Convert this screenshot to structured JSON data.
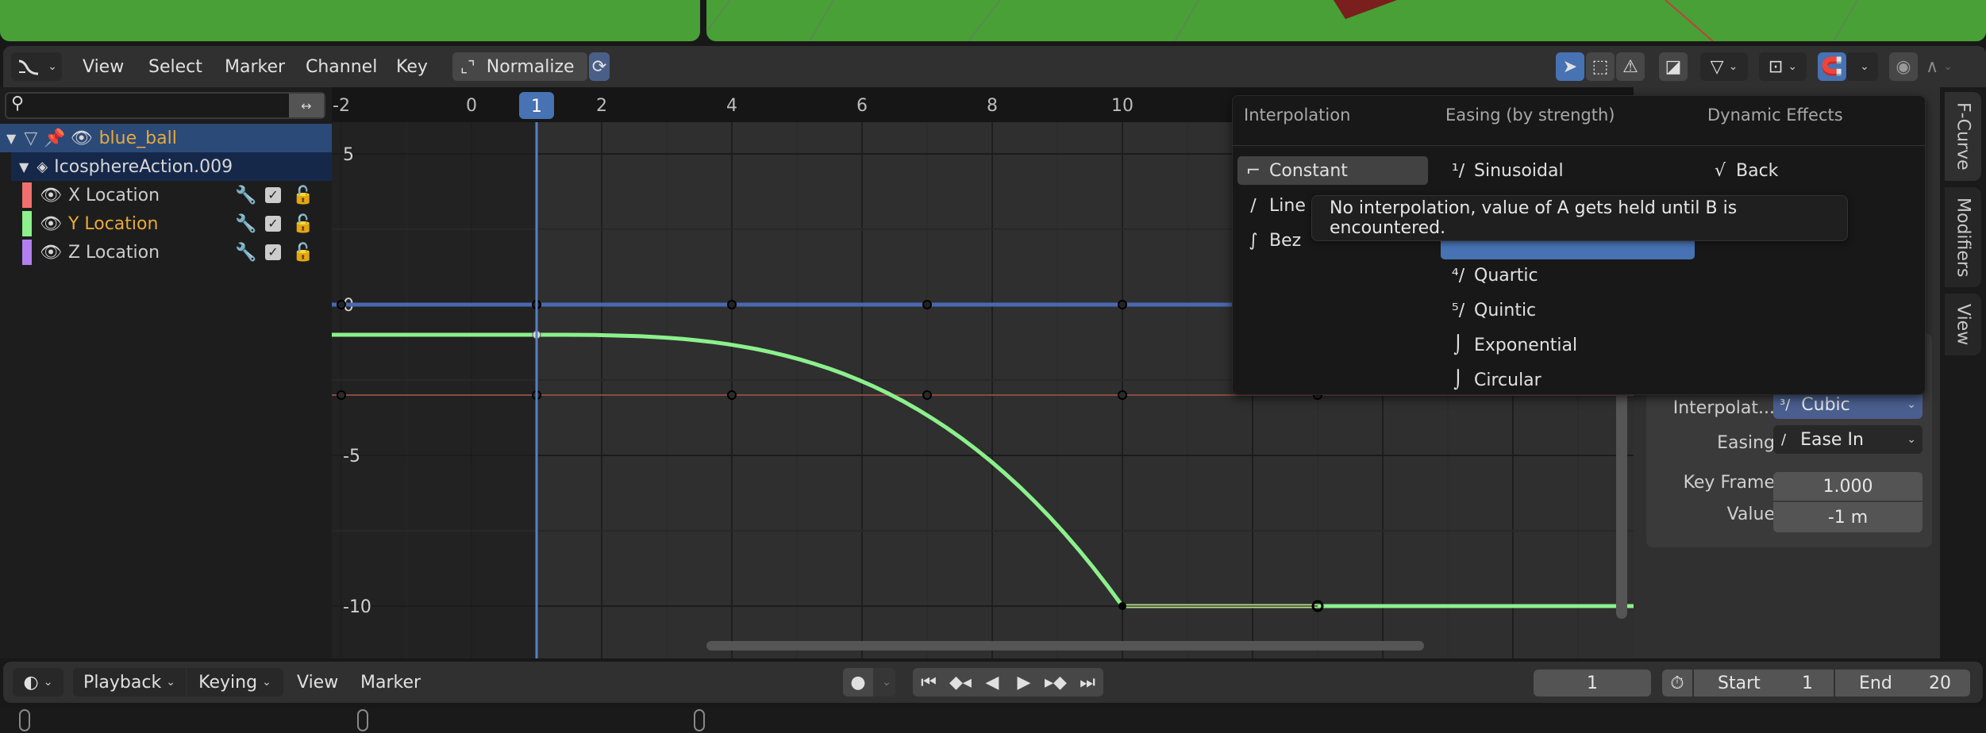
{
  "header": {
    "menus": [
      "View",
      "Select",
      "Marker",
      "Channel",
      "Key"
    ],
    "normalize_label": "Normalize"
  },
  "ruler": {
    "ticks": [
      "-2",
      "0",
      "2",
      "4",
      "6",
      "8",
      "10"
    ],
    "current_frame": "1"
  },
  "yaxis": {
    "ticks": [
      "5",
      "0",
      "-5",
      "-10"
    ]
  },
  "channels": {
    "object": "blue_ball",
    "action": "IcosphereAction.009",
    "fcurves": [
      {
        "label": "X Location",
        "color": "#f07070",
        "selected": false
      },
      {
        "label": "Y Location",
        "color": "#8cf08c",
        "selected": true
      },
      {
        "label": "Z Location",
        "color": "#b080f0",
        "selected": false
      }
    ]
  },
  "graph": {
    "curves": {
      "x_location": {
        "color": "#8a4a40",
        "value": -3,
        "keyframes": [
          -2,
          1,
          4,
          7,
          10,
          13
        ]
      },
      "z_location": {
        "color": "#4a68b0",
        "value": 0,
        "keyframes": [
          -2,
          1,
          4,
          7,
          10,
          13
        ]
      },
      "y_location": {
        "color": "#8cf08c",
        "keyframes": [
          [
            1,
            -1
          ],
          [
            10,
            -10
          ],
          [
            13,
            -10
          ]
        ],
        "interpolation": "Cubic",
        "easing": "Ease In"
      }
    }
  },
  "popup": {
    "columns": {
      "interpolation": {
        "title": "Interpolation",
        "items": [
          "Constant",
          "Line",
          "Bez"
        ]
      },
      "easing": {
        "title": "Easing (by strength)",
        "items": [
          "Sinusoidal",
          "Quartic",
          "Quintic",
          "Exponential",
          "Circular"
        ]
      },
      "dynamic": {
        "title": "Dynamic Effects",
        "items": [
          "Back"
        ]
      }
    },
    "highlighted_item": "Constant",
    "tooltip": "No interpolation, value of A gets held until B is encountered."
  },
  "sidepanel": {
    "interpolation_label": "Interpolat...",
    "interpolation_value": "Cubic",
    "easing_label": "Easing",
    "easing_value": "Ease In",
    "keyframe_label": "Key Frame",
    "keyframe_value": "1.000",
    "value_label": "Value",
    "value_value": "-1 m",
    "tabs": [
      "F-Curve",
      "Modifiers",
      "View"
    ]
  },
  "timeline": {
    "menus": [
      "Playback",
      "Keying",
      "View",
      "Marker"
    ],
    "current_frame": "1",
    "start_label": "Start",
    "start_value": "1",
    "end_label": "End",
    "end_value": "20"
  },
  "colors": {
    "accent": "#4772b3",
    "viewport_green": "#48a036"
  }
}
